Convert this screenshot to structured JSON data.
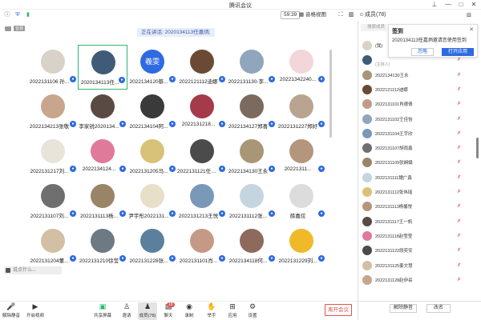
{
  "window": {
    "title": "腾讯会议",
    "meeting_time": "59:39",
    "view_label": "音格视图",
    "members_title": "成员(78)"
  },
  "video": {
    "camera_tag": "音源",
    "speaking_banner": "正在讲话: 2020134113任嘉炳;",
    "tiles": [
      {
        "name": "2022131106 孙...",
        "bg": "#d9d2c8"
      },
      {
        "name": "2020134113任...",
        "bg": "#3f5b77",
        "active": true
      },
      {
        "name": "2022134120蔡...",
        "bg": "#2f6be0",
        "text": "羲雯"
      },
      {
        "name": "2022121112迪娜",
        "bg": "#6b4a35"
      },
      {
        "name": "2022131130-李...",
        "bg": "#8fa6bd"
      },
      {
        "name": "20221342240...",
        "bg": "#f3d6d9"
      },
      {
        "name": "2022134213张敬",
        "bg": "#c7a68d"
      },
      {
        "name": "李家锐2020134...",
        "bg": "#5a4a44"
      },
      {
        "name": "2022134104阿...",
        "bg": "#3a3a3a"
      },
      {
        "name": "2022131218...",
        "bg": "#a43a4a"
      },
      {
        "name": "2022134127郑喜",
        "bg": "#7b6a5e"
      },
      {
        "name": "2022131227郑好",
        "bg": "#b9a48f"
      },
      {
        "name": "2022131217刘...",
        "bg": "#e8e4da"
      },
      {
        "name": "2022134124...",
        "bg": "#e07a9a"
      },
      {
        "name": "2022131205马...",
        "bg": "#d8c27a"
      },
      {
        "name": "2022131121任梓莹",
        "bg": "#4b4b4b"
      },
      {
        "name": "2022134130王永",
        "bg": "#a89677"
      },
      {
        "name": "20221311...",
        "bg": "#b4967c"
      },
      {
        "name": "2022131107刘...",
        "bg": "#6f6f6f"
      },
      {
        "name": "2022131113杨...",
        "bg": "#9a8468"
      },
      {
        "name": "尹宇彤2022131...",
        "bg": "#e8dfc9"
      },
      {
        "name": "2022131213王悦",
        "bg": "#7a98b8"
      },
      {
        "name": "2022131112张...",
        "bg": "#c5d5e0"
      },
      {
        "name": "薛嘉炫",
        "bg": "#dcdcdc"
      },
      {
        "name": "2022131204董...",
        "bg": "#d3c0a4"
      },
      {
        "name": "2022131210徐莹",
        "bg": "#6d7a84"
      },
      {
        "name": "2022131228张...",
        "bg": "#5d7f9e"
      },
      {
        "name": "2022131101肖...",
        "bg": "#c49a86"
      },
      {
        "name": "2022134118何...",
        "bg": "#8d6a5c"
      },
      {
        "name": "2022131229刘...",
        "bg": "#f0b92a"
      }
    ],
    "chat_placeholder": "说点什么..."
  },
  "bottom": {
    "mute_label": "解除静音",
    "video_label": "开启视频",
    "share_label": "共享屏幕",
    "invite_label": "邀请",
    "members_label": "成员(78)",
    "chat_label": "聊天",
    "chat_badge": "18",
    "record_label": "录制",
    "hand_label": "举手",
    "apps_label": "应用",
    "settings_label": "设置",
    "leave_label": "离开会议"
  },
  "panel": {
    "search_placeholder": "搜索成员",
    "popup": {
      "title": "签到",
      "body": "2020134113任嘉炳邀请您使用签到",
      "ignore": "忽略",
      "open": "打开应用"
    },
    "members": [
      {
        "name": "(我)",
        "sub": "",
        "bg": "#d9d2c8"
      },
      {
        "name": "",
        "sub": "(主持人)",
        "bg": "#3f5b77"
      },
      {
        "name": "2022134130王永",
        "bg": "#a89677"
      },
      {
        "name": "2022121112迪娜",
        "bg": "#6b4a35"
      },
      {
        "name": "2022131101肖德倩",
        "bg": "#c49a86"
      },
      {
        "name": "2022131102王佳怡",
        "bg": "#8fa6bd"
      },
      {
        "name": "2022131104王宇欣",
        "bg": "#7a98b8"
      },
      {
        "name": "2022131107胡雨鑫",
        "bg": "#6f6f6f"
      },
      {
        "name": "2022131109张娴娟",
        "bg": "#9a8468"
      },
      {
        "name": "2022131111魏广鑫",
        "bg": "#c5d5e0"
      },
      {
        "name": "2022131112张伟瑶",
        "bg": "#d8c27a"
      },
      {
        "name": "2022131113杨馨悦",
        "bg": "#b4967c"
      },
      {
        "name": "2022131117王一帆",
        "bg": "#5a4a44"
      },
      {
        "name": "2022131118赵莹莹",
        "bg": "#e07a9a"
      },
      {
        "name": "2022131122段奕安",
        "bg": "#4b4b4b"
      },
      {
        "name": "2022131125姜文慧",
        "bg": "#d3c0a4"
      },
      {
        "name": "2022131128赵伊岳",
        "bg": "#c7a68d"
      }
    ],
    "unmute_all": "解除静音",
    "rename": "改名"
  }
}
